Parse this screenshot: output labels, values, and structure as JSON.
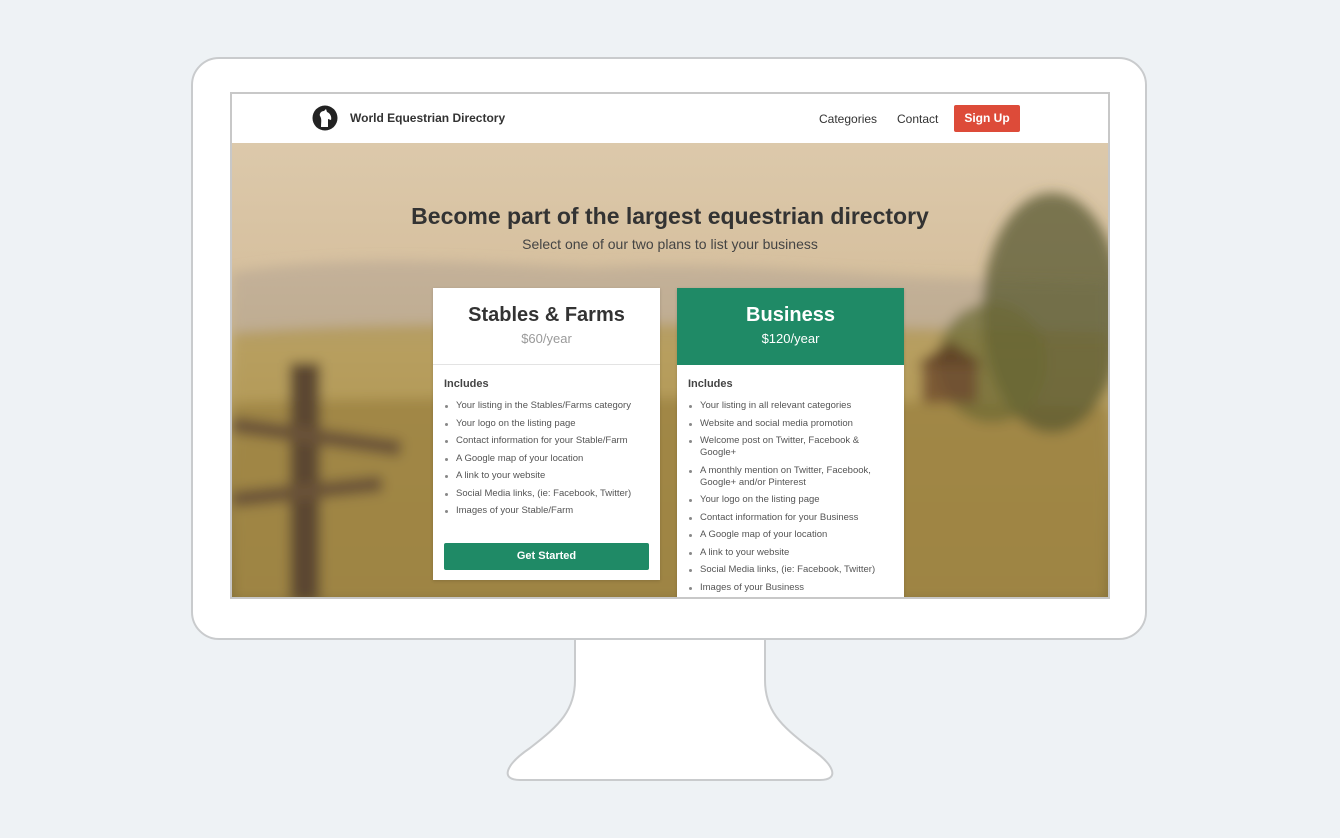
{
  "nav": {
    "brand": "World Equestrian Directory",
    "links": [
      "Categories",
      "Contact"
    ],
    "signup": "Sign Up"
  },
  "hero": {
    "headline": "Become part of the largest equestrian directory",
    "subhead": "Select one of our two plans to list your business"
  },
  "plans": [
    {
      "name": "Stables & Farms",
      "price": "$60/year",
      "includes_label": "Includes",
      "features": [
        "Your listing in the Stables/Farms category",
        "Your logo on the listing page",
        "Contact information for your Stable/Farm",
        "A Google map of your location",
        "A link to your website",
        "Social Media links, (ie: Facebook, Twitter)",
        "Images of your Stable/Farm"
      ],
      "cta": "Get Started"
    },
    {
      "name": "Business",
      "price": "$120/year",
      "includes_label": "Includes",
      "features": [
        "Your listing in all relevant categories",
        "Website and social media promotion",
        "Welcome post on Twitter, Facebook & Google+",
        "A monthly mention on Twitter, Facebook, Google+ and/or Pinterest",
        "Your logo on the listing page",
        "Contact information for your Business",
        "A Google map of your location",
        "A link to your website",
        "Social Media links, (ie: Facebook, Twitter)",
        "Images of your Business"
      ]
    }
  ],
  "colors": {
    "signup": "#dd4b39",
    "accent_green": "#1f8a66",
    "page_bg": "#eef2f5"
  }
}
